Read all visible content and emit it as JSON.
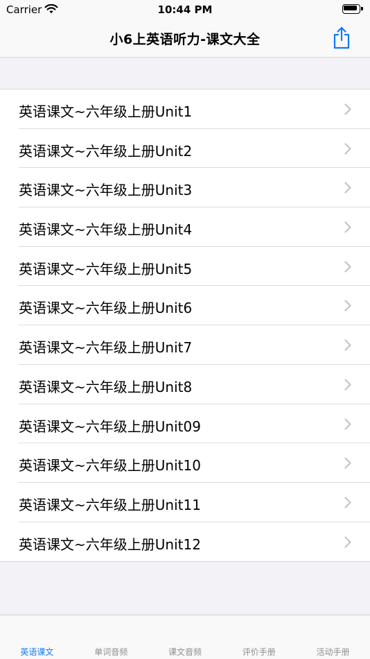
{
  "status_bar": {
    "carrier": "Carrier",
    "time": "10:44 PM"
  },
  "nav": {
    "title": "小6上英语听力-课文大全",
    "share_icon": "share-icon",
    "accent_color": "#1478f5"
  },
  "list": {
    "items": [
      {
        "label": "英语课文~六年级上册Unit1"
      },
      {
        "label": "英语课文~六年级上册Unit2"
      },
      {
        "label": "英语课文~六年级上册Unit3"
      },
      {
        "label": "英语课文~六年级上册Unit4"
      },
      {
        "label": "英语课文~六年级上册Unit5"
      },
      {
        "label": "英语课文~六年级上册Unit6"
      },
      {
        "label": "英语课文~六年级上册Unit7"
      },
      {
        "label": "英语课文~六年级上册Unit8"
      },
      {
        "label": "英语课文~六年级上册Unit09"
      },
      {
        "label": "英语课文~六年级上册Unit10"
      },
      {
        "label": "英语课文~六年级上册Unit11"
      },
      {
        "label": "英语课文~六年级上册Unit12"
      }
    ]
  },
  "tab_bar": {
    "tabs": [
      {
        "label": "英语课文",
        "active": true
      },
      {
        "label": "单词音频",
        "active": false
      },
      {
        "label": "课文音频",
        "active": false
      },
      {
        "label": "评价手册",
        "active": false
      },
      {
        "label": "活动手册",
        "active": false
      }
    ]
  }
}
